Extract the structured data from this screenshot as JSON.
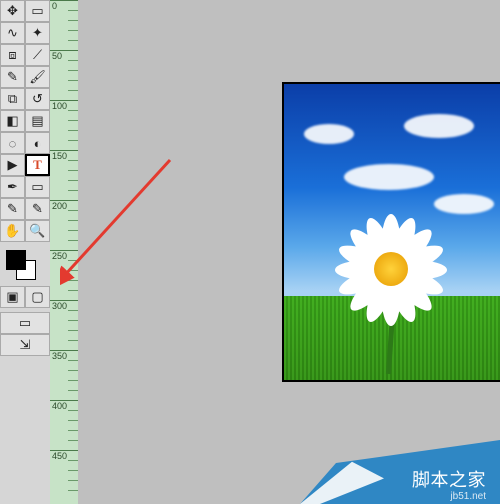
{
  "toolbox": {
    "tools": [
      {
        "n": "move",
        "g": "✥"
      },
      {
        "n": "marquee",
        "g": "▭"
      },
      {
        "n": "lasso",
        "g": "∿"
      },
      {
        "n": "magic-wand",
        "g": "✦"
      },
      {
        "n": "crop",
        "g": "⧈"
      },
      {
        "n": "slice",
        "g": "⟋"
      },
      {
        "n": "healing-brush",
        "g": "✎"
      },
      {
        "n": "brush",
        "g": "🖌"
      },
      {
        "n": "clone-stamp",
        "g": "⧉"
      },
      {
        "n": "history-brush",
        "g": "↺"
      },
      {
        "n": "eraser",
        "g": "◧"
      },
      {
        "n": "gradient",
        "g": "▤"
      },
      {
        "n": "blur",
        "g": "◌"
      },
      {
        "n": "dodge",
        "g": "◐"
      },
      {
        "n": "path-selection",
        "g": "▶"
      },
      {
        "n": "type",
        "g": "T",
        "selected": true,
        "color": "#d84a2a"
      },
      {
        "n": "pen",
        "g": "✒"
      },
      {
        "n": "shape",
        "g": "▭"
      },
      {
        "n": "notes",
        "g": "✎"
      },
      {
        "n": "eyedropper",
        "g": "✎"
      },
      {
        "n": "hand",
        "g": "✋"
      },
      {
        "n": "zoom",
        "g": "🔍"
      }
    ],
    "modes": [
      {
        "n": "standard-mode",
        "g": "▣"
      },
      {
        "n": "quickmask-mode",
        "g": "▢"
      }
    ],
    "extras": [
      {
        "n": "screen-mode",
        "g": "▭"
      },
      {
        "n": "jump-to",
        "g": "⇲"
      }
    ]
  },
  "ruler": {
    "majors": [
      0,
      50,
      100,
      150,
      200,
      250,
      300,
      350,
      400,
      450
    ],
    "labels": [
      "0",
      "50",
      "100",
      "150",
      "200",
      "250",
      "300",
      "350",
      "400",
      "450"
    ]
  },
  "annotation": {
    "arrow_color": "#e33a2f"
  },
  "watermark": {
    "site": "脚本之家",
    "url": "jb51.net"
  }
}
